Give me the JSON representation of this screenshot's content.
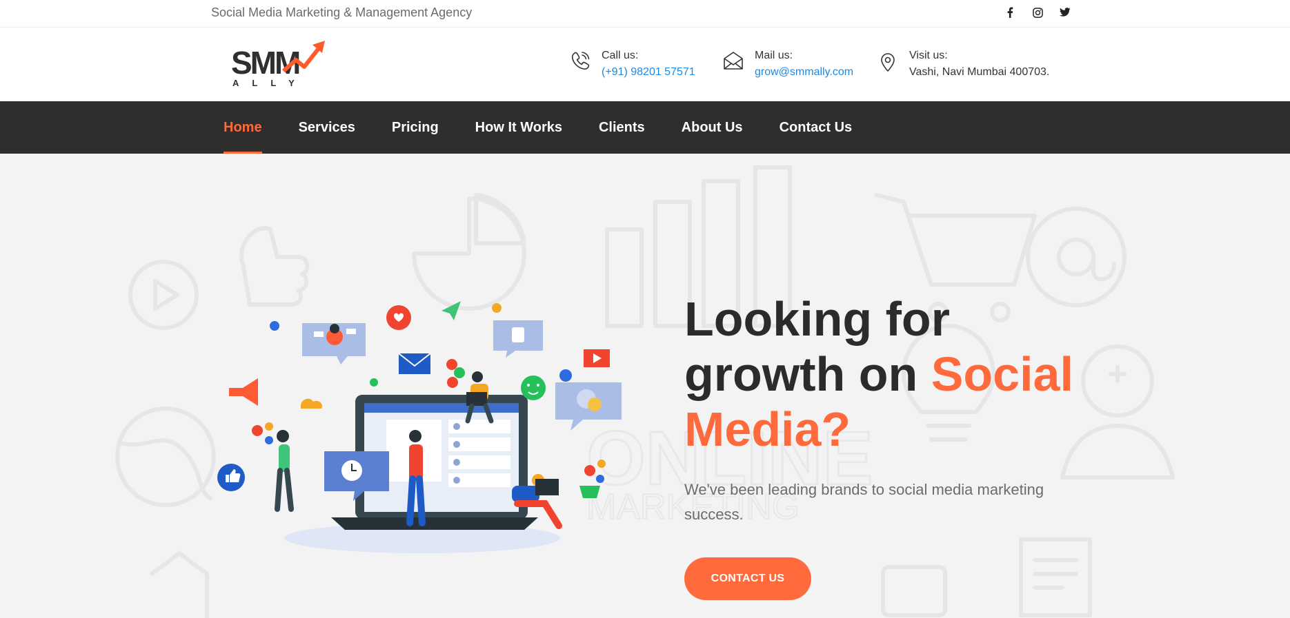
{
  "topbar": {
    "tagline": "Social Media Marketing & Management Agency",
    "socials": [
      {
        "icon": "facebook-icon"
      },
      {
        "icon": "instagram-icon"
      },
      {
        "icon": "twitter-icon"
      }
    ]
  },
  "header": {
    "logo": {
      "main": "SMM",
      "sub": "ALLY"
    },
    "call": {
      "label": "Call us:",
      "value": "(+91) 98201 57571"
    },
    "mail": {
      "label": "Mail us:",
      "value": "grow@smmally.com"
    },
    "visit": {
      "label": "Visit us:",
      "value": "Vashi, Navi Mumbai 400703."
    }
  },
  "nav": {
    "items": [
      "Home",
      "Services",
      "Pricing",
      "How It Works",
      "Clients",
      "About Us",
      "Contact Us"
    ],
    "active": "Home"
  },
  "hero": {
    "headline_line1": "Looking for",
    "headline_line2": "growth on ",
    "headline_accent1": "Social",
    "headline_accent2": "Media?",
    "subtext": "We've been leading brands to social media marketing success.",
    "cta": "CONTACT US"
  },
  "colors": {
    "accent": "#ff6a3d",
    "nav_bg": "#2e2e2c",
    "link": "#1e88e5"
  }
}
